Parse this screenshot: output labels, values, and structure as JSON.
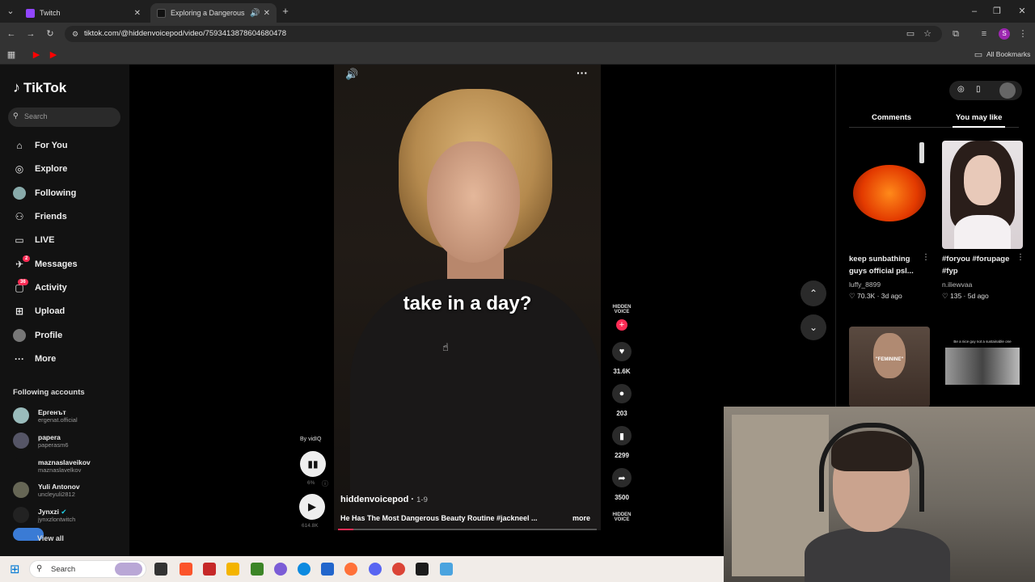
{
  "browser": {
    "tabs": [
      {
        "title": "Twitch",
        "favicon_color": "#9146ff"
      },
      {
        "title": "Exploring a Dangerous Beau",
        "favicon_color": "#111111"
      }
    ],
    "url": "tiktok.com/@hiddenvoicepod/video/7593413878604680478",
    "bookmarks_label": "All Bookmarks",
    "profile_initial": "S"
  },
  "sidebar": {
    "logo": "TikTok",
    "search_placeholder": "Search",
    "nav": [
      {
        "label": "For You",
        "icon": "home-icon"
      },
      {
        "label": "Explore",
        "icon": "compass-icon"
      },
      {
        "label": "Following",
        "icon": "following-avatar"
      },
      {
        "label": "Friends",
        "icon": "friends-icon"
      },
      {
        "label": "LIVE",
        "icon": "live-icon"
      },
      {
        "label": "Messages",
        "icon": "messages-icon",
        "badge": "2"
      },
      {
        "label": "Activity",
        "icon": "activity-icon",
        "badge": "36"
      },
      {
        "label": "Upload",
        "icon": "upload-icon"
      },
      {
        "label": "Profile",
        "icon": "profile-avatar"
      },
      {
        "label": "More",
        "icon": "more-icon"
      }
    ],
    "following_title": "Following accounts",
    "accounts": [
      {
        "name": "Ергенът",
        "handle": "ergenat.official"
      },
      {
        "name": "papera",
        "handle": "paperasm6"
      },
      {
        "name": "maznaslaveikov",
        "handle": "maznaslavelkov"
      },
      {
        "name": "Yuli Antonov",
        "handle": "uncleyuli2812"
      },
      {
        "name": "Jynxzi",
        "handle": "jynxzlontwitch"
      }
    ],
    "view_all": "View all"
  },
  "video": {
    "caption": "take in a day?",
    "author": "hiddenvoicepod",
    "date": "1-9",
    "description": "He Has The Most Dangerous Beauty Routine  #jackneel ...",
    "more": "more",
    "progress": 0.06,
    "actions": {
      "likes": "31.6K",
      "comments": "203",
      "saves": "2299",
      "shares": "3500"
    },
    "channel_logo_text": "HIDDEN VOICE"
  },
  "vidiq": {
    "by": "By vidIQ",
    "percent": "6%",
    "views": "614.8K"
  },
  "right_panel": {
    "tabs": [
      "Comments",
      "You may like"
    ],
    "active_tab": "You may like",
    "cards": [
      {
        "title": "keep sunbathing guys official psl...",
        "user": "luffy_8899",
        "likes": "70.3K",
        "age": "3d ago"
      },
      {
        "title": "#foryou #forupage #fyp",
        "user": "n.iliewvaa",
        "likes": "135",
        "age": "5d ago"
      }
    ],
    "thumb_text_3": "\"FEMININE\"",
    "thumb_text_4": "Be a nice guy not a sustainable one"
  },
  "taskbar": {
    "search_placeholder": "Search"
  },
  "colors": {
    "accent": "#fe2c55",
    "background": "#000000",
    "sidebar": "#121212"
  }
}
